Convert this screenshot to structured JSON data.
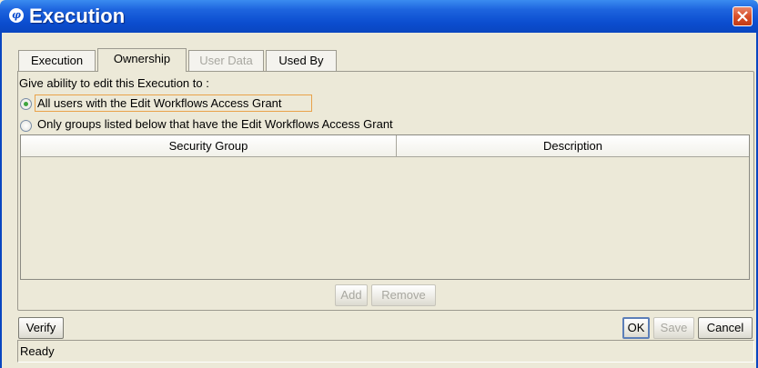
{
  "window": {
    "title": "Execution",
    "logo_text": "φ",
    "accent_color": "#0b4dcf"
  },
  "tabs": [
    {
      "label": "Execution",
      "state": "normal"
    },
    {
      "label": "Ownership",
      "state": "active"
    },
    {
      "label": "User Data",
      "state": "disabled"
    },
    {
      "label": "Used By",
      "state": "normal"
    }
  ],
  "ownership": {
    "prompt": "Give ability to edit this Execution to :",
    "option_all": "All users with the Edit Workflows Access Grant",
    "option_groups": "Only groups listed below that have the Edit Workflows Access Grant",
    "selected": "all"
  },
  "table": {
    "columns": [
      "Security Group",
      "Description"
    ],
    "rows": []
  },
  "table_buttons": {
    "add": "Add",
    "remove": "Remove"
  },
  "footer": {
    "verify": "Verify",
    "ok": "OK",
    "save": "Save",
    "cancel": "Cancel"
  },
  "status": {
    "text": "Ready"
  },
  "icons": {
    "close": "close-icon",
    "logo": "hp-logo-icon"
  }
}
